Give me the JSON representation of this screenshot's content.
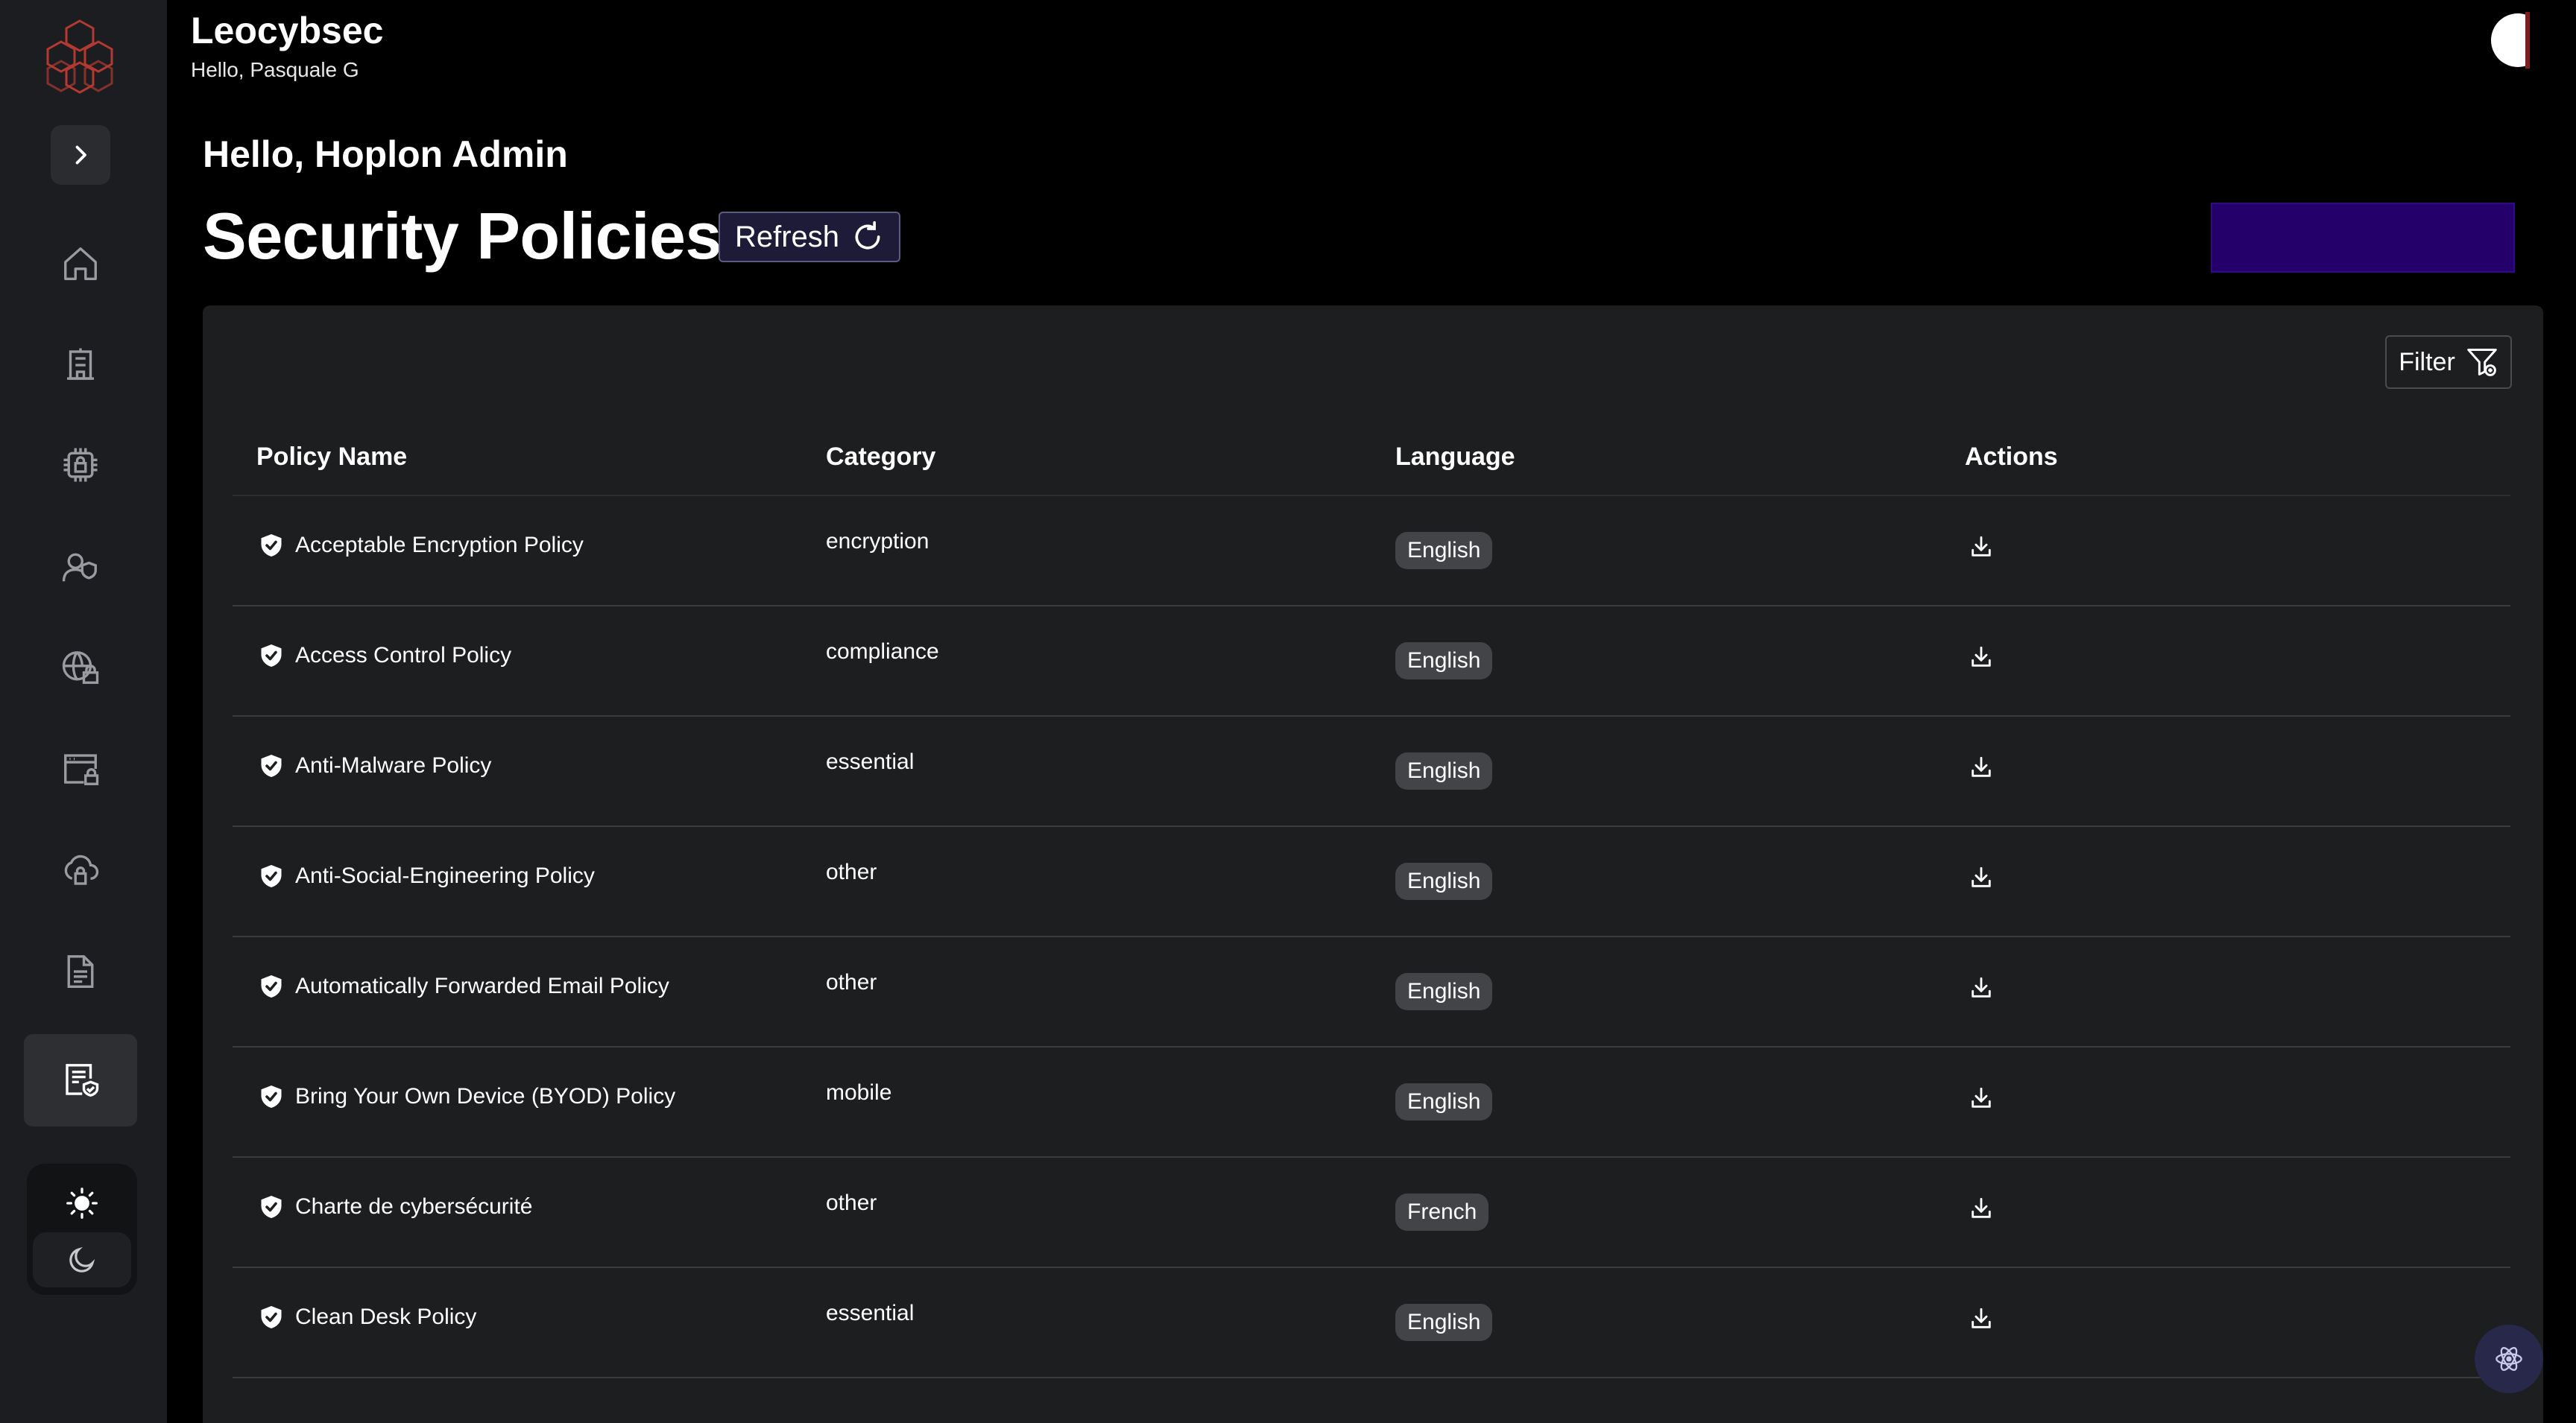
{
  "header": {
    "brand": "Leocybsec",
    "greeting": "Hello, Pasquale G"
  },
  "page": {
    "hello": "Hello, Hoplon Admin",
    "title": "Security Policies",
    "refresh_label": "Refresh",
    "filter_label": "Filter"
  },
  "sidebar": {
    "items": [
      {
        "icon": "home-icon"
      },
      {
        "icon": "building-icon"
      },
      {
        "icon": "chip-lock-icon"
      },
      {
        "icon": "user-shield-icon"
      },
      {
        "icon": "globe-lock-icon"
      },
      {
        "icon": "browser-lock-icon"
      },
      {
        "icon": "cloud-lock-icon"
      },
      {
        "icon": "document-icon"
      },
      {
        "icon": "policy-shield-icon",
        "active": true
      }
    ]
  },
  "table": {
    "columns": [
      "Policy Name",
      "Category",
      "Language",
      "Actions"
    ],
    "rows": [
      {
        "name": "Acceptable Encryption Policy",
        "category": "encryption",
        "language": "English"
      },
      {
        "name": "Access Control Policy",
        "category": "compliance",
        "language": "English"
      },
      {
        "name": "Anti-Malware Policy",
        "category": "essential",
        "language": "English"
      },
      {
        "name": "Anti-Social-Engineering Policy",
        "category": "other",
        "language": "English"
      },
      {
        "name": "Automatically Forwarded Email Policy",
        "category": "other",
        "language": "English"
      },
      {
        "name": "Bring Your Own Device (BYOD) Policy",
        "category": "mobile",
        "language": "English"
      },
      {
        "name": "Charte de cybersécurité",
        "category": "other",
        "language": "French"
      },
      {
        "name": "Clean Desk Policy",
        "category": "essential",
        "language": "English"
      }
    ]
  },
  "colors": {
    "accent_purple": "#24006b",
    "logo_red": "#c0392b",
    "background": "#000000",
    "card": "#1d1e20"
  }
}
